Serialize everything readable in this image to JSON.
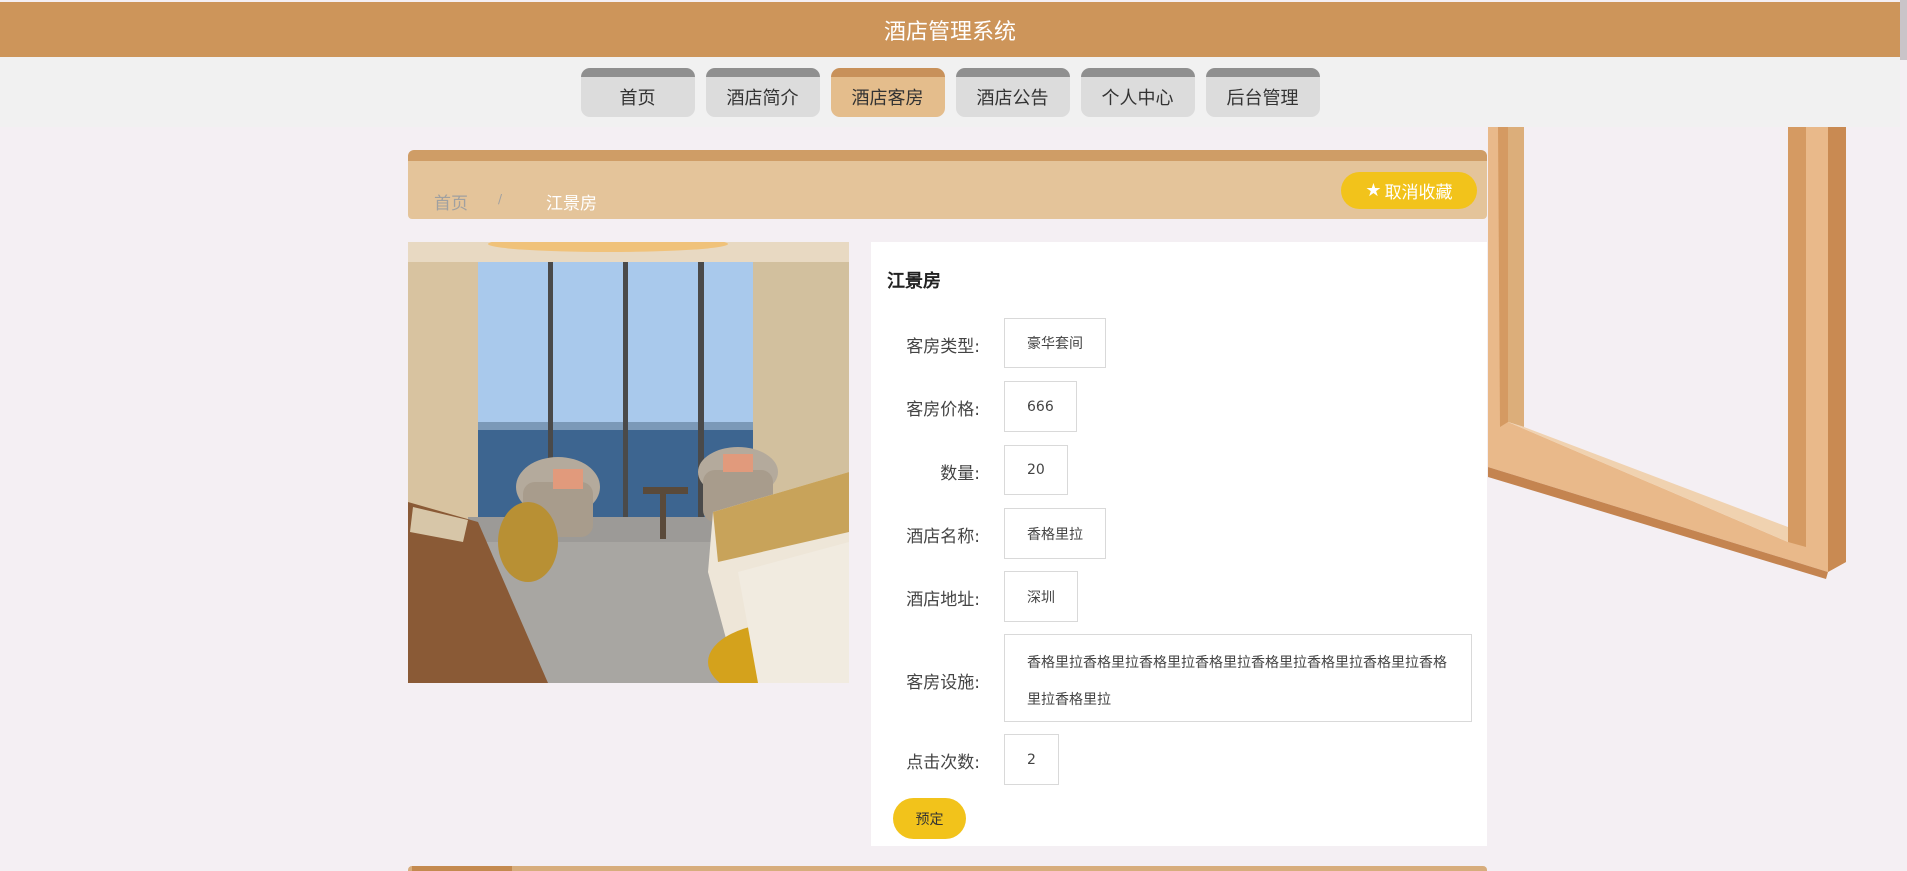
{
  "app_title": "酒店管理系统",
  "nav": {
    "items": [
      {
        "label": "首页",
        "active": false
      },
      {
        "label": "酒店简介",
        "active": false
      },
      {
        "label": "酒店客房",
        "active": true
      },
      {
        "label": "酒店公告",
        "active": false
      },
      {
        "label": "个人中心",
        "active": false
      },
      {
        "label": "后台管理",
        "active": false
      }
    ]
  },
  "breadcrumb": {
    "home": "首页",
    "separator": "/",
    "current": "江景房"
  },
  "favorite_button": {
    "icon": "star-icon",
    "label": "取消收藏"
  },
  "room": {
    "title": "江景房",
    "fields": [
      {
        "label": "客房类型:",
        "value": "豪华套间"
      },
      {
        "label": "客房价格:",
        "value": "666"
      },
      {
        "label": "数量:",
        "value": "20"
      },
      {
        "label": "酒店名称:",
        "value": "香格里拉"
      },
      {
        "label": "酒店地址:",
        "value": "深圳"
      },
      {
        "label": "客房设施:",
        "value": "香格里拉香格里拉香格里拉香格里拉香格里拉香格里拉香格里拉香格里拉香格里拉"
      },
      {
        "label": "点击次数:",
        "value": "2"
      }
    ]
  },
  "book_button": "预定",
  "colors": {
    "header": "#cd955a",
    "accent_yellow": "#f2c31b",
    "active_tab": "#e4bd8c",
    "background": "#f4eff3"
  }
}
